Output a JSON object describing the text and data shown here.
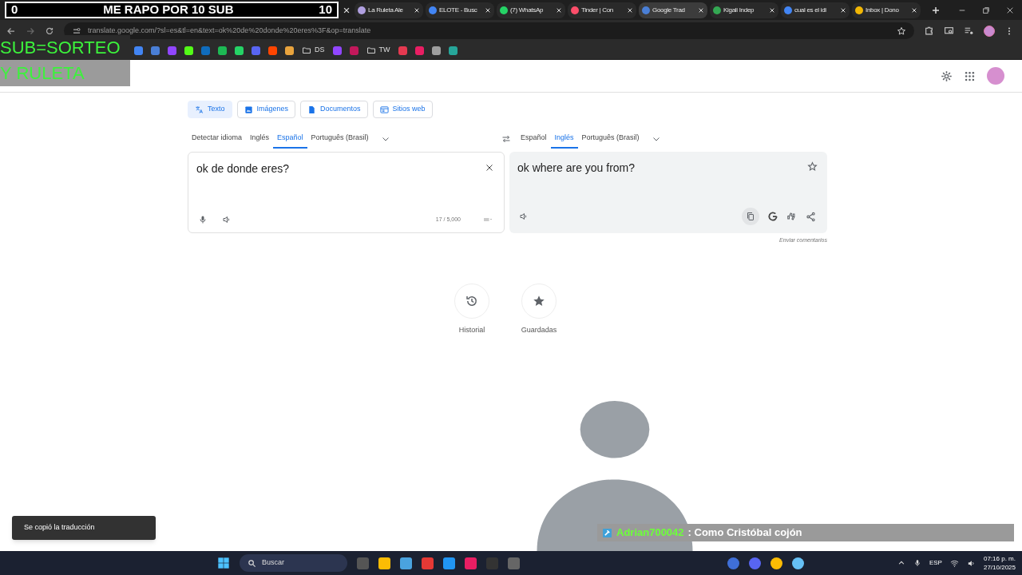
{
  "stream_overlay": {
    "left_count": "0",
    "title": "ME RAPO POR 10 SUB",
    "right_count": "10"
  },
  "tabs": [
    {
      "title": "La Ruleta Ale",
      "selected": false,
      "color": "#b0a0e0"
    },
    {
      "title": "ELOTE - Busc",
      "selected": false,
      "color": "#4285f4"
    },
    {
      "title": "(7) WhatsAp",
      "selected": false,
      "color": "#25d366"
    },
    {
      "title": "Tinder | Con",
      "selected": false,
      "color": "#fd4e6a"
    },
    {
      "title": "Google Trad",
      "selected": true,
      "color": "#4a7fd6"
    },
    {
      "title": "Kigali Indep",
      "selected": false,
      "color": "#34a853"
    },
    {
      "title": "cual es el idi",
      "selected": false,
      "color": "#4285f4"
    },
    {
      "title": "Inbox | Dono",
      "selected": false,
      "color": "#f2b705"
    }
  ],
  "address_bar": {
    "url": "translate.google.com/?sl=es&tl=en&text=ok%20de%20donde%20eres%3F&op=translate"
  },
  "giveaway_overlay": {
    "line_1": "SUB=SORTEO",
    "line_2": "Y RULETA"
  },
  "bookmarks": [
    {
      "kind": "icon",
      "color": "#4285f4"
    },
    {
      "kind": "icon",
      "color": "#4a7fd6"
    },
    {
      "kind": "icon",
      "color": "#9146ff"
    },
    {
      "kind": "icon",
      "color": "#53fc18"
    },
    {
      "kind": "icon",
      "color": "#0f6cbd"
    },
    {
      "kind": "icon",
      "color": "#1db954"
    },
    {
      "kind": "icon",
      "color": "#25d366"
    },
    {
      "kind": "icon",
      "color": "#5865f2"
    },
    {
      "kind": "icon",
      "color": "#ff4500"
    },
    {
      "kind": "icon",
      "color": "#e8a33d"
    },
    {
      "kind": "folder",
      "label": "DS"
    },
    {
      "kind": "icon",
      "color": "#9146ff"
    },
    {
      "kind": "icon",
      "color": "#c2185b"
    },
    {
      "kind": "folder",
      "label": "TW"
    },
    {
      "kind": "icon",
      "color": "#e53950"
    },
    {
      "kind": "icon",
      "color": "#e91e63"
    },
    {
      "kind": "icon",
      "color": "#9e9e9e"
    },
    {
      "kind": "icon",
      "color": "#26a69a"
    }
  ],
  "modes": [
    {
      "label": "Texto",
      "selected": true
    },
    {
      "label": "Imágenes",
      "selected": false
    },
    {
      "label": "Documentos",
      "selected": false
    },
    {
      "label": "Sitios web",
      "selected": false
    }
  ],
  "source_languages": [
    {
      "label": "Detectar idioma",
      "selected": false
    },
    {
      "label": "Inglés",
      "selected": false
    },
    {
      "label": "Español",
      "selected": true
    },
    {
      "label": "Português (Brasil)",
      "selected": false
    }
  ],
  "target_languages": [
    {
      "label": "Español",
      "selected": false
    },
    {
      "label": "Inglés",
      "selected": true
    },
    {
      "label": "Português (Brasil)",
      "selected": false
    }
  ],
  "source_text": "ok de donde eres?",
  "char_count": "17 / 5,000",
  "translation": "ok where are you from?",
  "feedback_link": "Enviar comentarios",
  "shortcuts": [
    {
      "kind": "history",
      "label": "Historial"
    },
    {
      "kind": "saved",
      "label": "Guardadas"
    }
  ],
  "toast": "Se copió la traducción",
  "chat_message": {
    "user": "Adrian700042",
    "text": ": Como Cristóbal cojón"
  },
  "taskbar": {
    "search_placeholder": "Buscar",
    "language": "ESP",
    "time": "07:16 p. m.",
    "date": "27/10/2025"
  }
}
